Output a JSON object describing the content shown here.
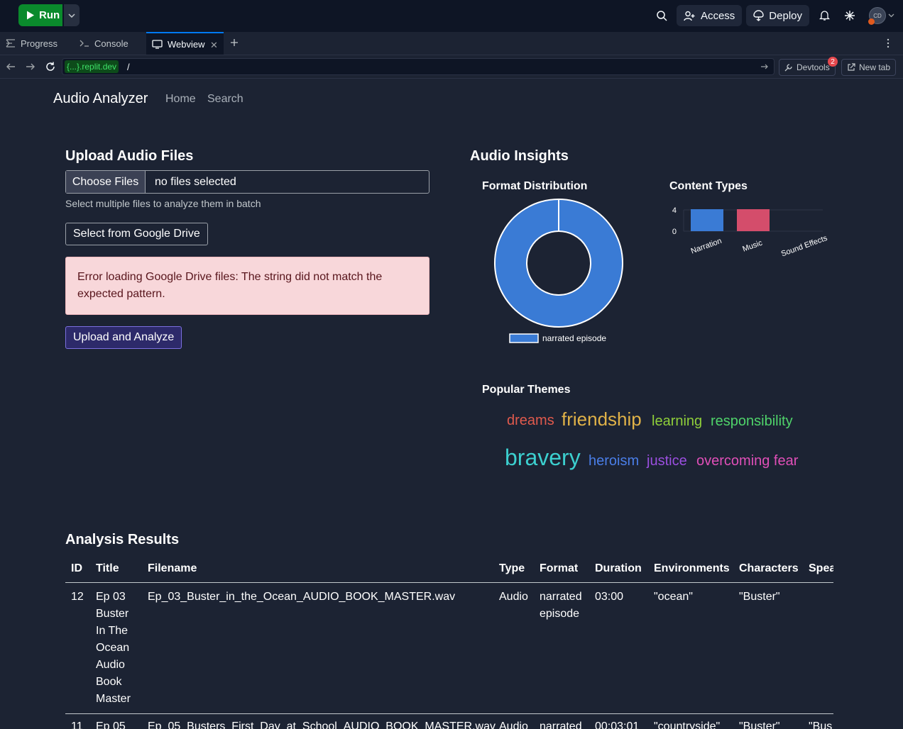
{
  "topbar": {
    "run_label": "Run",
    "access_label": "Access",
    "deploy_label": "Deploy",
    "avatar_initials": "CD"
  },
  "tabs": [
    {
      "label": "Progress"
    },
    {
      "label": "Console"
    },
    {
      "label": "Webview"
    }
  ],
  "urlbar": {
    "host": "{...}.replit.dev",
    "path": "/",
    "devtools_label": "Devtools",
    "devtools_badge": "2",
    "newtab_label": "New tab"
  },
  "page": {
    "brand": "Audio Analyzer",
    "nav": [
      "Home",
      "Search"
    ],
    "upload": {
      "heading": "Upload Audio Files",
      "choose_label": "Choose Files",
      "file_status": "no files selected",
      "hint": "Select multiple files to analyze them in batch",
      "drive_button": "Select from Google Drive",
      "error_line1": "Error loading Google Drive files: The string did not match the",
      "error_line2": "expected pattern.",
      "submit_button": "Upload and Analyze"
    },
    "insights": {
      "heading": "Audio Insights",
      "format_title": "Format Distribution",
      "content_title": "Content Types",
      "themes_title": "Popular Themes"
    },
    "results": {
      "heading": "Analysis Results",
      "columns": [
        "ID",
        "Title",
        "Filename",
        "Type",
        "Format",
        "Duration",
        "Environments",
        "Characters",
        "Spea"
      ],
      "rows": [
        {
          "id": "12",
          "title_lines": [
            "Ep 03",
            "Buster",
            "In The",
            "Ocean",
            "Audio",
            "Book",
            "Master"
          ],
          "filename": "Ep_03_Buster_in_the_Ocean_AUDIO_BOOK_MASTER.wav",
          "type": "Audio",
          "format_lines": [
            "narrated",
            "episode"
          ],
          "duration": "03:00",
          "environments": "\"ocean\"",
          "characters": "\"Buster\"",
          "speakers": ""
        },
        {
          "id": "11",
          "title_lines": [
            "Ep 05"
          ],
          "filename": "Ep_05_Busters_First_Day_at_School_AUDIO_BOOK_MASTER.wav",
          "type": "Audio",
          "format_lines": [
            "narrated"
          ],
          "duration": "00:03:01",
          "environments": "\"countryside\"",
          "characters": "\"Buster\"",
          "speakers": "\"Bus"
        }
      ]
    }
  },
  "chart_data": [
    {
      "type": "pie",
      "title": "Format Distribution",
      "labels": [
        "narrated episode"
      ],
      "values": [
        1
      ],
      "colors": [
        "#3a7bd5"
      ],
      "legend": "bottom"
    },
    {
      "type": "bar",
      "title": "Content Types",
      "categories": [
        "Narration",
        "Music",
        "Sound Effects"
      ],
      "values": [
        4,
        4,
        0
      ],
      "colors": [
        "#3a7bd5",
        "#d44d6b"
      ],
      "yticks": [
        "4",
        "0"
      ],
      "ylim": [
        0,
        4
      ]
    }
  ],
  "themes": [
    {
      "word": "dreams",
      "color": "#e05a4d"
    },
    {
      "word": "friendship",
      "color": "#e0b248"
    },
    {
      "word": "learning",
      "color": "#8fcf3a"
    },
    {
      "word": "responsibility",
      "color": "#4fd36a"
    },
    {
      "word": "bravery",
      "color": "#3ccfcf"
    },
    {
      "word": "heroism",
      "color": "#4a7ee8"
    },
    {
      "word": "justice",
      "color": "#9b4fe0"
    },
    {
      "word": "overcoming fear",
      "color": "#e04fb8"
    }
  ]
}
